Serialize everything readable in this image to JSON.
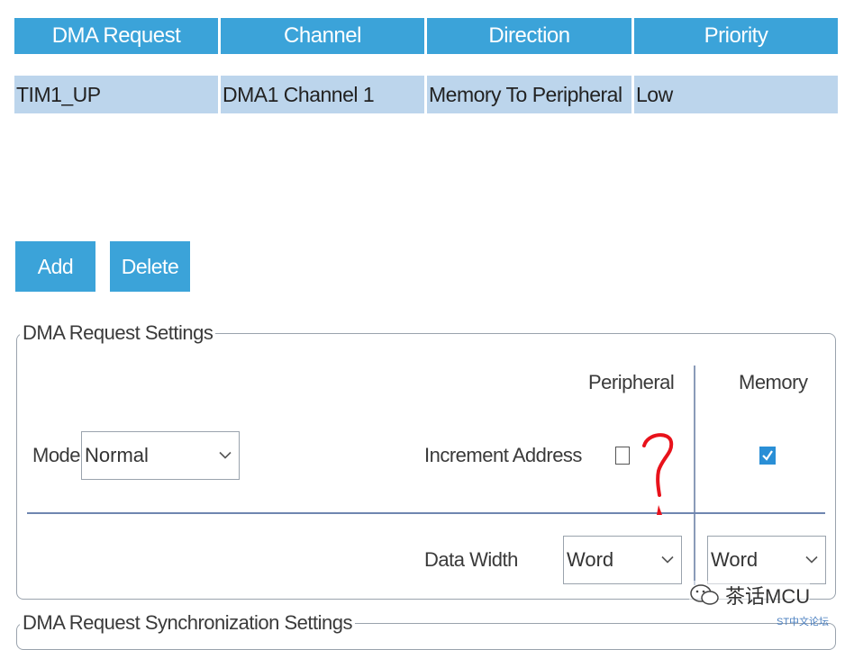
{
  "table": {
    "headers": [
      "DMA Request",
      "Channel",
      "Direction",
      "Priority"
    ],
    "rows": [
      [
        "TIM1_UP",
        "DMA1 Channel 1",
        "Memory To Peripheral",
        "Low"
      ]
    ]
  },
  "buttons": {
    "add": "Add",
    "delete": "Delete"
  },
  "settings": {
    "legend": "DMA Request Settings",
    "col_peripheral": "Peripheral",
    "col_memory": "Memory",
    "mode_label": "Mode",
    "mode_value": "Normal",
    "increment_label": "Increment Address",
    "peripheral_increment_checked": false,
    "memory_increment_checked": true,
    "data_width_label": "Data Width",
    "peripheral_data_width": "Word",
    "memory_data_width": "Word"
  },
  "sync_legend": "DMA Request Synchronization Settings",
  "annotation": "?",
  "watermark": {
    "text": "茶话MCU",
    "sub": "ST中文论坛"
  },
  "colors": {
    "accent": "#3ba3d9",
    "row_bg": "#bcd5ec",
    "check": "#2a8fd6",
    "annotation": "#e8121b"
  }
}
